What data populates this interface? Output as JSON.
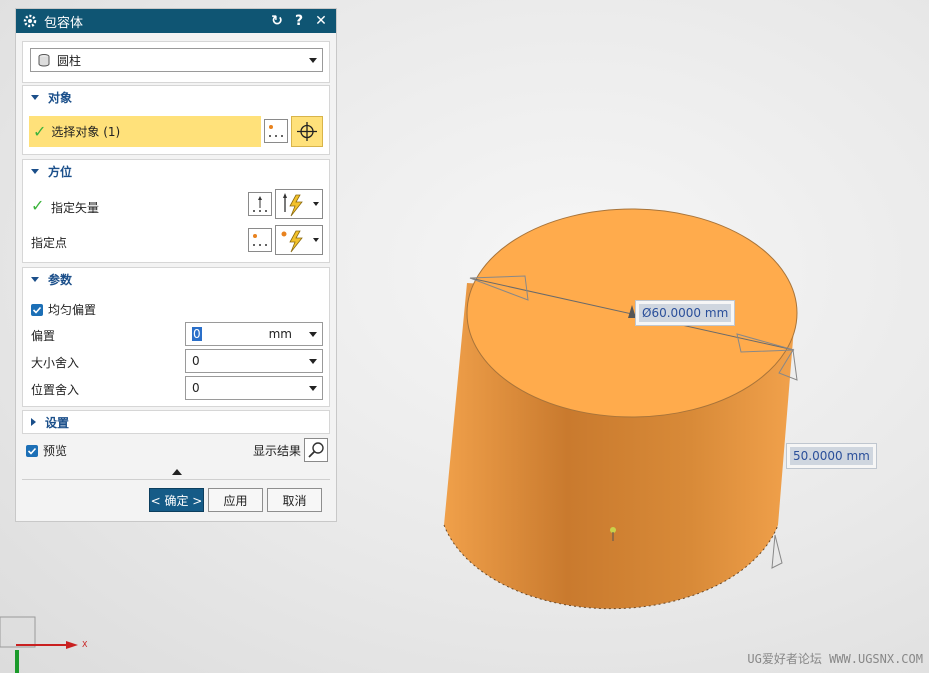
{
  "dialog": {
    "title": "包容体",
    "type_select": {
      "value": "圆柱",
      "icon": "cylinder-icon"
    },
    "sections": {
      "object": {
        "title": "对象",
        "select_label": "选择对象 (1)"
      },
      "orientation": {
        "title": "方位",
        "vector_label": "指定矢量",
        "point_label": "指定点"
      },
      "params": {
        "title": "参数",
        "uniform_offset_label": "均匀偏置",
        "offset_label": "偏置",
        "offset_value": "0",
        "offset_unit": "mm",
        "size_round_label": "大小舍入",
        "size_round_value": "0",
        "pos_round_label": "位置舍入",
        "pos_round_value": "0"
      },
      "settings": {
        "title": "设置"
      }
    },
    "preview_label": "预览",
    "show_result_label": "显示结果",
    "buttons": {
      "ok": "< 确定 >",
      "apply": "应用",
      "cancel": "取消"
    }
  },
  "viewport": {
    "diameter_label": "Ø60.0000 mm",
    "height_label": "50.0000 mm",
    "axis_x_label": "X",
    "watermark": "UG爱好者论坛 WWW.UGSNX.COM"
  },
  "colors": {
    "titlebar": "#0f5573",
    "selection_highlight": "#ffe17a",
    "cylinder_top": "#ffaa4a",
    "cylinder_side": "#d98a3a",
    "checkmark": "#3cb43c"
  }
}
